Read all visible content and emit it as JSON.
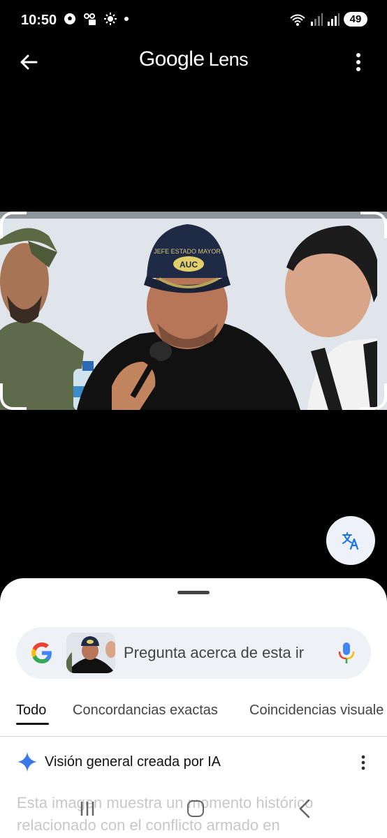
{
  "status": {
    "time": "10:50",
    "battery": "49"
  },
  "appbar": {
    "brand_google": "Google",
    "brand_lens": "Lens"
  },
  "image": {
    "cap_text_1": "JEFE ESTADO MAYOR",
    "cap_text_2": "AUC"
  },
  "search": {
    "placeholder": "Pregunta acerca de esta ir"
  },
  "tabs": [
    {
      "label": "Todo"
    },
    {
      "label": "Concordancias exactas"
    },
    {
      "label": "Coincidencias visuale"
    }
  ],
  "ai_overview": {
    "title": "Visión general creada por IA",
    "text": "Esta imagen muestra un momento histórico relacionado con el conflicto armado en"
  },
  "colors": {
    "accent": "#1a73e8",
    "google_blue": "#4285F4",
    "google_red": "#EA4335",
    "google_yellow": "#FBBC05",
    "google_green": "#34A853"
  }
}
